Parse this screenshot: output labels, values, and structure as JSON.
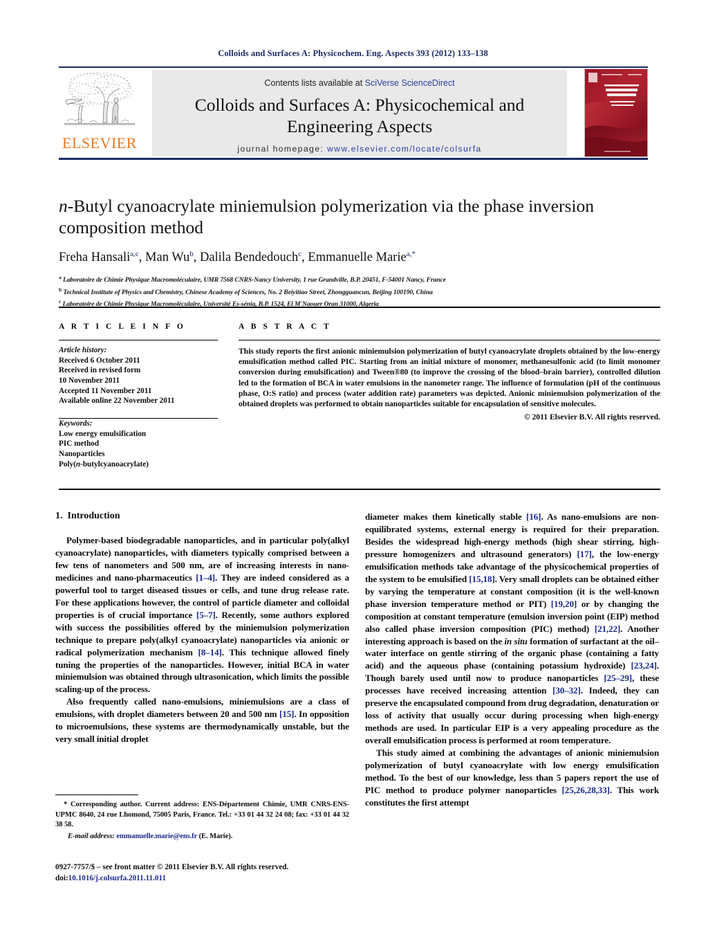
{
  "running_head": "Colloids and Surfaces A: Physicochem. Eng. Aspects 393 (2012) 133–138",
  "masthead": {
    "contents_prefix": "Contents lists available at ",
    "sciencedirect": "SciVerse ScienceDirect",
    "journal_title_line1": "Colloids and Surfaces A: Physicochemical and",
    "journal_title_line2": "Engineering Aspects",
    "homepage_label": "journal homepage:",
    "homepage_url": "www.elsevier.com/locate/colsurfa",
    "publisher": "ELSEVIER",
    "cover_title_line1": "COLLOIDS AND",
    "cover_title_line2": "SURFACES A",
    "cover_sub_line1": "Physicochemical and",
    "cover_sub_line2": "Engineering Aspects"
  },
  "article": {
    "title": "n-Butyl cyanoacrylate miniemulsion polymerization via the phase inversion composition method",
    "authors": [
      {
        "name": "Freha Hansali",
        "sup": "a,c",
        "sep": ", "
      },
      {
        "name": "Man Wu",
        "sup": "b",
        "sep": ", "
      },
      {
        "name": "Dalila Bendedouch",
        "sup": "c",
        "sep": ", "
      },
      {
        "name": "Emmanuelle Marie",
        "sup": "a,",
        "sep": ""
      }
    ],
    "affiliations": [
      {
        "mark": "a",
        "text": "Laboratoire de Chimie Physique Macromoléculaire, UMR 7568 CNRS-Nancy University, 1 rue Grandville, B.P. 20451, F-54001 Nancy, France"
      },
      {
        "mark": "b",
        "text": "Technical Institute of Physics and Chemistry, Chinese Academy of Sciences, No. 2 Beiyitiao Street, Zhongguancun, Beijing 100190, China"
      },
      {
        "mark": "c",
        "text": "Laboratoire de Chimie Physique Macromoléculaire, Université Es-sénia, B.P. 1524, El M'Naouer Oran 31000, Algeria"
      }
    ]
  },
  "article_info": {
    "heading": "A R T I C L E    I N F O",
    "history_label": "Article history:",
    "history": [
      "Received 6 October 2011",
      "Received in revised form",
      "10 November 2011",
      "Accepted 11 November 2011",
      "Available online 22 November 2011"
    ],
    "keywords_label": "Keywords:",
    "keywords": [
      "Low energy emulsification",
      "PIC method",
      "Nanoparticles",
      "Poly(n-butylcyanoacrylate)"
    ]
  },
  "abstract": {
    "heading": "A B S T R A C T",
    "text": "This study reports the first anionic miniemulsion polymerization of butyl cyanoacrylate droplets obtained by the low-energy emulsification method called PIC. Starting from an initial mixture of monomer, methanesulfonic acid (to limit monomer conversion during emulsification) and Tween®80 (to improve the crossing of the blood–brain barrier), controlled dilution led to the formation of BCA in water emulsions in the nanometer range. The influence of formulation (pH of the continuous phase, O:S ratio) and process (water addition rate) parameters was depicted. Anionic miniemulsion polymerization of the obtained droplets was performed to obtain nanoparticles suitable for encapsulation of sensitive molecules.",
    "copyright": "© 2011 Elsevier B.V. All rights reserved."
  },
  "body": {
    "section_number": "1.",
    "section_title": "Introduction",
    "left_paragraphs": [
      "Polymer-based biodegradable nanoparticles, and in particular poly(alkyl cyanoacrylate) nanoparticles, with diameters typically comprised between a few tens of nanometers and 500 nm, are of increasing interests in nano-medicines and nano-pharmaceutics [1–4]. They are indeed considered as a powerful tool to target diseased tissues or cells, and tune drug release rate. For these applications however, the control of particle diameter and colloidal properties is of crucial importance [5–7]. Recently, some authors explored with success the possibilities offered by the miniemulsion polymerization technique to prepare poly(alkyl cyanoacrylate) nanoparticles via anionic or radical polymerization mechanism [8–14]. This technique allowed finely tuning the properties of the nanoparticles. However, initial BCA in water miniemulsion was obtained through ultrasonication, which limits the possible scaling-up of the process.",
      "Also frequently called nano-emulsions, miniemulsions are a class of emulsions, with droplet diameters between 20 and 500 nm [15]. In opposition to microemulsions, these systems are thermodynamically unstable, but the very small initial droplet"
    ],
    "right_paragraphs": [
      "diameter makes them kinetically stable [16]. As nano-emulsions are non-equilibrated systems, external energy is required for their preparation. Besides the widespread high-energy methods (high shear stirring, high-pressure homogenizers and ultrasound generators) [17], the low-energy emulsification methods take advantage of the physicochemical properties of the system to be emulsified [15,18]. Very small droplets can be obtained either by varying the temperature at constant composition (it is the well-known phase inversion temperature method or PIT) [19,20] or by changing the composition at constant temperature (emulsion inversion point (EIP) method also called phase inversion composition (PIC) method) [21,22]. Another interesting approach is based on the in situ formation of surfactant at the oil–water interface on gentle stirring of the organic phase (containing a fatty acid) and the aqueous phase (containing potassium hydroxide) [23,24]. Though barely used until now to produce nanoparticles [25–29], these processes have received increasing attention [30–32]. Indeed, they can preserve the encapsulated compound from drug degradation, denaturation or loss of activity that usually occur during processing when high-energy methods are used. In particular EIP is a very appealing procedure as the overall emulsification process is performed at room temperature.",
      "This study aimed at combining the advantages of anionic miniemulsion polymerization of butyl cyanoacrylate with low energy emulsification method. To the best of our knowledge, less than 5 papers report the use of PIC method to produce polymer nanoparticles [25,26,28,33]. This work constitutes the first attempt"
    ]
  },
  "footnote": {
    "corresponding": "* Corresponding author. Current address: ENS-Département Chimie, UMR CNRS-ENS-UPMC 8640, 24 rue Lhomond, 75005 Paris, France. Tel.: +33 01 44 32 24 08; fax: +33 01 44 32 38 58.",
    "email_label": "E-mail address:",
    "email": "emmanuelle.marie@ens.fr",
    "email_suffix": "(E. Marie)."
  },
  "imprint": {
    "issn_line": "0927-7757/$ – see front matter © 2011 Elsevier B.V. All rights reserved.",
    "doi_label": "doi:",
    "doi_value": "10.1016/j.colsurfa.2011.11.011"
  },
  "colors": {
    "navy": "#1b2a62",
    "link_blue": "#2a3fa0",
    "ref_blue": "#1b2a8a",
    "elsevier_orange": "#e87722",
    "band_gray": "#e9e9e9",
    "cover_red": "#8c1122"
  }
}
